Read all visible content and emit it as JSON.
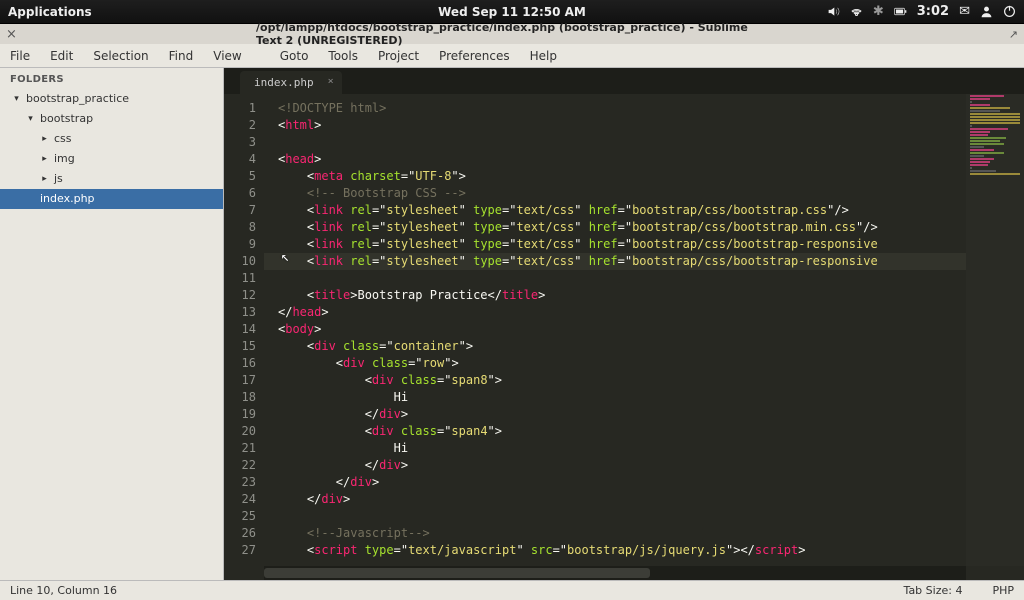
{
  "os": {
    "applications": "Applications",
    "clock_center": "Wed Sep 11 12:50 AM",
    "time_right": "3:02"
  },
  "window": {
    "title": "/opt/lampp/htdocs/bootstrap_practice/index.php (bootstrap_practice) - Sublime Text 2 (UNREGISTERED)"
  },
  "menu": {
    "file": "File",
    "edit": "Edit",
    "selection": "Selection",
    "find": "Find",
    "view": "View",
    "goto": "Goto",
    "tools": "Tools",
    "project": "Project",
    "preferences": "Preferences",
    "help": "Help"
  },
  "sidebar": {
    "header": "FOLDERS",
    "root": "bootstrap_practice",
    "l1": "bootstrap",
    "css": "css",
    "img": "img",
    "js": "js",
    "file_index": "index.php"
  },
  "tab": {
    "name": "index.php"
  },
  "gutter": [
    "1",
    "2",
    "3",
    "4",
    "5",
    "6",
    "7",
    "8",
    "9",
    "10",
    "11",
    "12",
    "13",
    "14",
    "15",
    "16",
    "17",
    "18",
    "19",
    "20",
    "21",
    "22",
    "23",
    "24",
    "25",
    "26",
    "27"
  ],
  "code": {
    "l1": "<!DOCTYPE html>",
    "l2o": "<",
    "l2t": "html",
    "l2c": ">",
    "l4o": "<",
    "l4t": "head",
    "l4c": ">",
    "l5a": "    <",
    "l5t": "meta",
    "l5sp": " ",
    "l5attr": "charset",
    "l5eq": "=\"",
    "l5v": "UTF-8",
    "l5end": "\">",
    "l6": "    <!-- Bootstrap CSS -->",
    "l7a": "    <",
    "l7t": "link",
    "l7r": " rel",
    "l7rv": "stylesheet",
    "l7ty": " type",
    "l7tv": "text/css",
    "l7h": " href",
    "l7hv": "bootstrap/css/bootstrap.css",
    "l7end": "/>",
    "l8hv": "bootstrap/css/bootstrap.min.css",
    "l8end": "/>",
    "l9hv": "bootstrap/css/bootstrap-responsive",
    "l9end": "",
    "l10hv": "bootstrap/css/bootstrap-responsive",
    "l10end": "",
    "l12a": "    <",
    "l12t": "title",
    "l12c": ">",
    "l12txt": "Bootstrap Practice",
    "l12ca": "</",
    "l12cc": ">",
    "l13a": "</",
    "l13t": "head",
    "l13c": ">",
    "l14a": "<",
    "l14t": "body",
    "l14c": ">",
    "l15a": "    <",
    "l15t": "div",
    "l15at": " class",
    "l15av": "container",
    "l15c": ">",
    "l16a": "        <",
    "l16t": "div",
    "l16at": " class",
    "l16av": "row",
    "l16c": ">",
    "l17a": "            <",
    "l17t": "div",
    "l17at": " class",
    "l17av": "span8",
    "l17c": ">",
    "l18": "                Hi",
    "l19a": "            </",
    "l19t": "div",
    "l19c": ">",
    "l20a": "            <",
    "l20t": "div",
    "l20at": " class",
    "l20av": "span4",
    "l20c": ">",
    "l21": "                Hi",
    "l22a": "            </",
    "l22t": "div",
    "l22c": ">",
    "l23a": "        </",
    "l23t": "div",
    "l23c": ">",
    "l24a": "    </",
    "l24t": "div",
    "l24c": ">",
    "l26": "    <!--Javascript-->",
    "l27a": "    <",
    "l27t": "script",
    "l27ty": " type",
    "l27tv": "text/javascript",
    "l27s": " src",
    "l27sv": "bootstrap/js/jquery.js",
    "l27c": "></",
    "l27c2": ">"
  },
  "status": {
    "pos": "Line 10, Column 16",
    "tabsize": "Tab Size: 4",
    "lang": "PHP"
  }
}
